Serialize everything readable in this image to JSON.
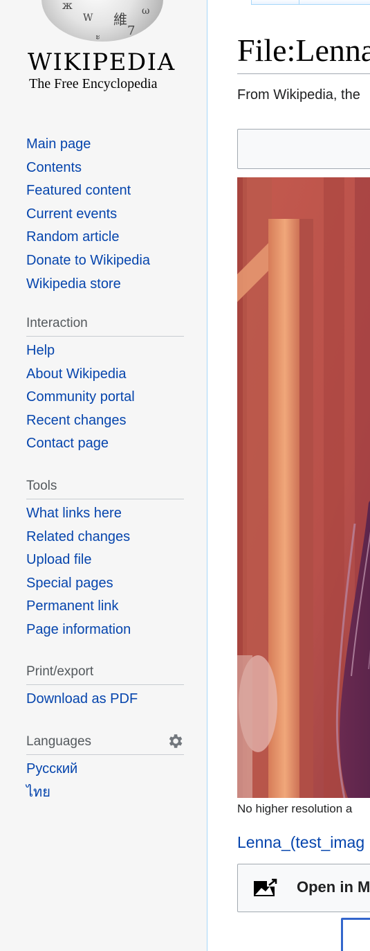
{
  "logo": {
    "wordmark": "WIKIPEDIA",
    "tagline": "The Free Encyclopedia"
  },
  "navigation": {
    "items": [
      {
        "label": "Main page"
      },
      {
        "label": "Contents"
      },
      {
        "label": "Featured content"
      },
      {
        "label": "Current events"
      },
      {
        "label": "Random article"
      },
      {
        "label": "Donate to Wikipedia"
      },
      {
        "label": "Wikipedia store"
      }
    ]
  },
  "interaction": {
    "heading": "Interaction",
    "items": [
      {
        "label": "Help"
      },
      {
        "label": "About Wikipedia"
      },
      {
        "label": "Community portal"
      },
      {
        "label": "Recent changes"
      },
      {
        "label": "Contact page"
      }
    ]
  },
  "tools": {
    "heading": "Tools",
    "items": [
      {
        "label": "What links here"
      },
      {
        "label": "Related changes"
      },
      {
        "label": "Upload file"
      },
      {
        "label": "Special pages"
      },
      {
        "label": "Permanent link"
      },
      {
        "label": "Page information"
      }
    ]
  },
  "print_export": {
    "heading": "Print/export",
    "items": [
      {
        "label": "Download as PDF"
      }
    ]
  },
  "languages": {
    "heading": "Languages",
    "settings_icon": "gear-icon",
    "items": [
      {
        "label": "Русский"
      },
      {
        "label": "ไทย"
      }
    ]
  },
  "content": {
    "title": "File:Lenna",
    "subtitle": "From Wikipedia, the",
    "resolution_note": "No higher resolution a",
    "file_link": "Lenna_(test_imag",
    "open_media_label": "Open in M",
    "open_media_icon": "open-media-viewer-icon"
  },
  "colors": {
    "link": "#0645ad",
    "sidebar_bg": "#f6f6f6",
    "border_accent": "#a7d7f9"
  }
}
